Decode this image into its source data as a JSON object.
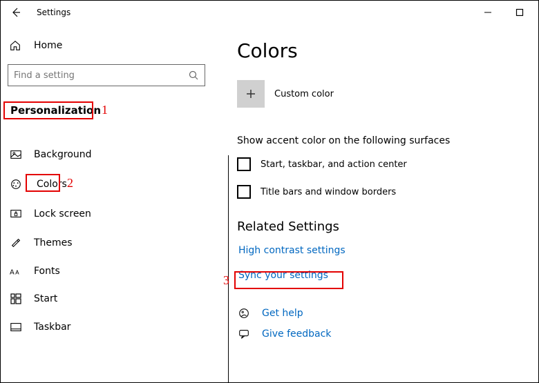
{
  "window": {
    "title": "Settings"
  },
  "sidebar": {
    "home": "Home",
    "search_placeholder": "Find a setting",
    "category": "Personalization",
    "items": [
      {
        "label": "Background"
      },
      {
        "label": "Colors"
      },
      {
        "label": "Lock screen"
      },
      {
        "label": "Themes"
      },
      {
        "label": "Fonts"
      },
      {
        "label": "Start"
      },
      {
        "label": "Taskbar"
      }
    ]
  },
  "main": {
    "title": "Colors",
    "custom_color_label": "Custom color",
    "accent_heading": "Show accent color on the following surfaces",
    "checks": [
      "Start, taskbar, and action center",
      "Title bars and window borders"
    ],
    "related_heading": "Related Settings",
    "links": [
      "High contrast settings",
      "Sync your settings"
    ],
    "help": [
      "Get help",
      "Give feedback"
    ]
  },
  "annotations": {
    "n1": "1",
    "n2": "2",
    "n3": "3"
  }
}
